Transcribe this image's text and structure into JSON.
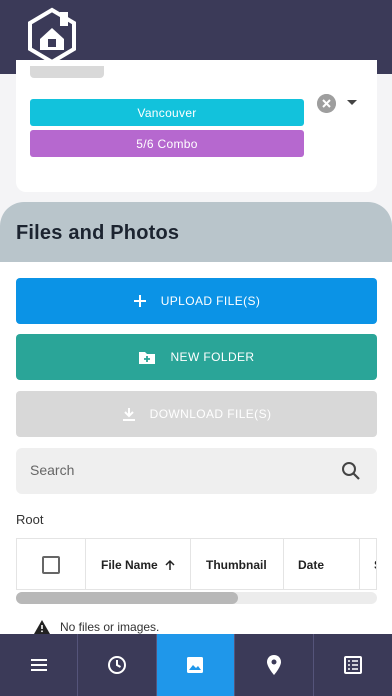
{
  "header": {
    "logo_icon": "house-shield-logo-icon"
  },
  "tags": {
    "chips": [
      {
        "label": "Vancouver",
        "color": "#12c2dc"
      },
      {
        "label": "5/6 Combo",
        "color": "#b668cf"
      }
    ],
    "clear_icon": "clear-circle-x-icon",
    "dropdown_icon": "caret-down-icon"
  },
  "files": {
    "title": "Files and Photos",
    "buttons": {
      "upload": "UPLOAD FILE(S)",
      "new_folder": "NEW FOLDER",
      "download": "DOWNLOAD FILE(S)"
    },
    "search": {
      "placeholder": "Search"
    },
    "breadcrumb": "Root",
    "table": {
      "columns": [
        "",
        "File Name",
        "Thumbnail",
        "Date",
        "S"
      ],
      "sort_column": "File Name",
      "sort_direction": "ascending"
    },
    "empty_message": "No files or images."
  },
  "bottom_nav": {
    "items": [
      {
        "icon": "menu-icon",
        "active": false
      },
      {
        "icon": "clock-icon",
        "active": false
      },
      {
        "icon": "image-icon",
        "active": true
      },
      {
        "icon": "location-pin-icon",
        "active": false
      },
      {
        "icon": "list-document-icon",
        "active": false
      }
    ]
  },
  "colors": {
    "topbar": "#3b3a58",
    "upload": "#0b93e6",
    "new_folder": "#2aa598",
    "download_disabled": "#d8d8d8",
    "active_nav": "#1f97ea"
  }
}
